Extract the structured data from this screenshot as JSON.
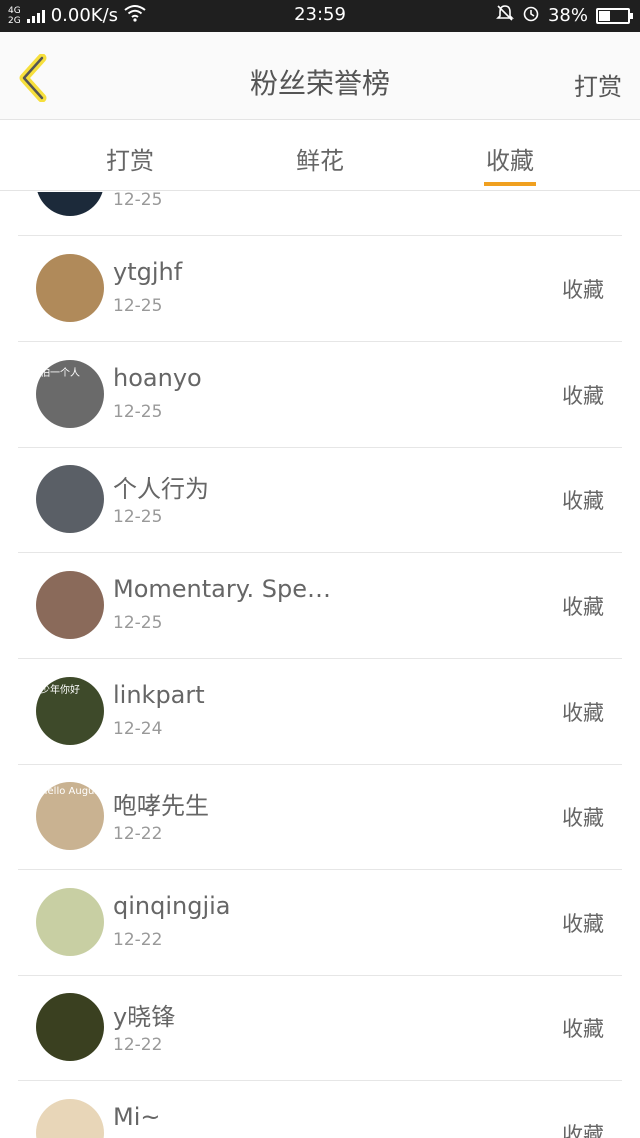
{
  "status": {
    "net_top": "4G",
    "net_bottom": "2G",
    "speed": "0.00K/s",
    "time": "23:59",
    "battery": "38%",
    "battery_level": 0.38
  },
  "header": {
    "title": "粉丝荣誉榜",
    "right_action": "打赏"
  },
  "tabs": [
    {
      "label": "打赏"
    },
    {
      "label": "鲜花"
    },
    {
      "label": "收藏"
    }
  ],
  "active_tab": 2,
  "rows": [
    {
      "name": "",
      "date": "12-25",
      "action": "",
      "avatar_color": "#1c2a3a"
    },
    {
      "name": "ytgjhf",
      "date": "12-25",
      "action": "收藏",
      "avatar_color": "#b08a5a"
    },
    {
      "name": "hoanyo",
      "date": "12-25",
      "action": "收藏",
      "avatar_color": "#6a6a6a",
      "avatar_text": "怕一个人"
    },
    {
      "name": "个人行为",
      "date": "12-25",
      "action": "收藏",
      "avatar_color": "#5a5f66"
    },
    {
      "name": "Momentary. Spe…",
      "date": "12-25",
      "action": "收藏",
      "avatar_color": "#8a6a5a"
    },
    {
      "name": "linkpart",
      "date": "12-24",
      "action": "收藏",
      "avatar_color": "#3e4a2a",
      "avatar_text": "少年你好"
    },
    {
      "name": "咆哮先生",
      "date": "12-22",
      "action": "收藏",
      "avatar_color": "#c9b291",
      "avatar_text": "Hello August"
    },
    {
      "name": "qinqingjia",
      "date": "12-22",
      "action": "收藏",
      "avatar_color": "#c8cfa3"
    },
    {
      "name": "y晓锋",
      "date": "12-22",
      "action": "收藏",
      "avatar_color": "#3a4020"
    },
    {
      "name": "Mi~",
      "date": "",
      "action": "收藏",
      "avatar_color": "#e8d6b8"
    }
  ]
}
